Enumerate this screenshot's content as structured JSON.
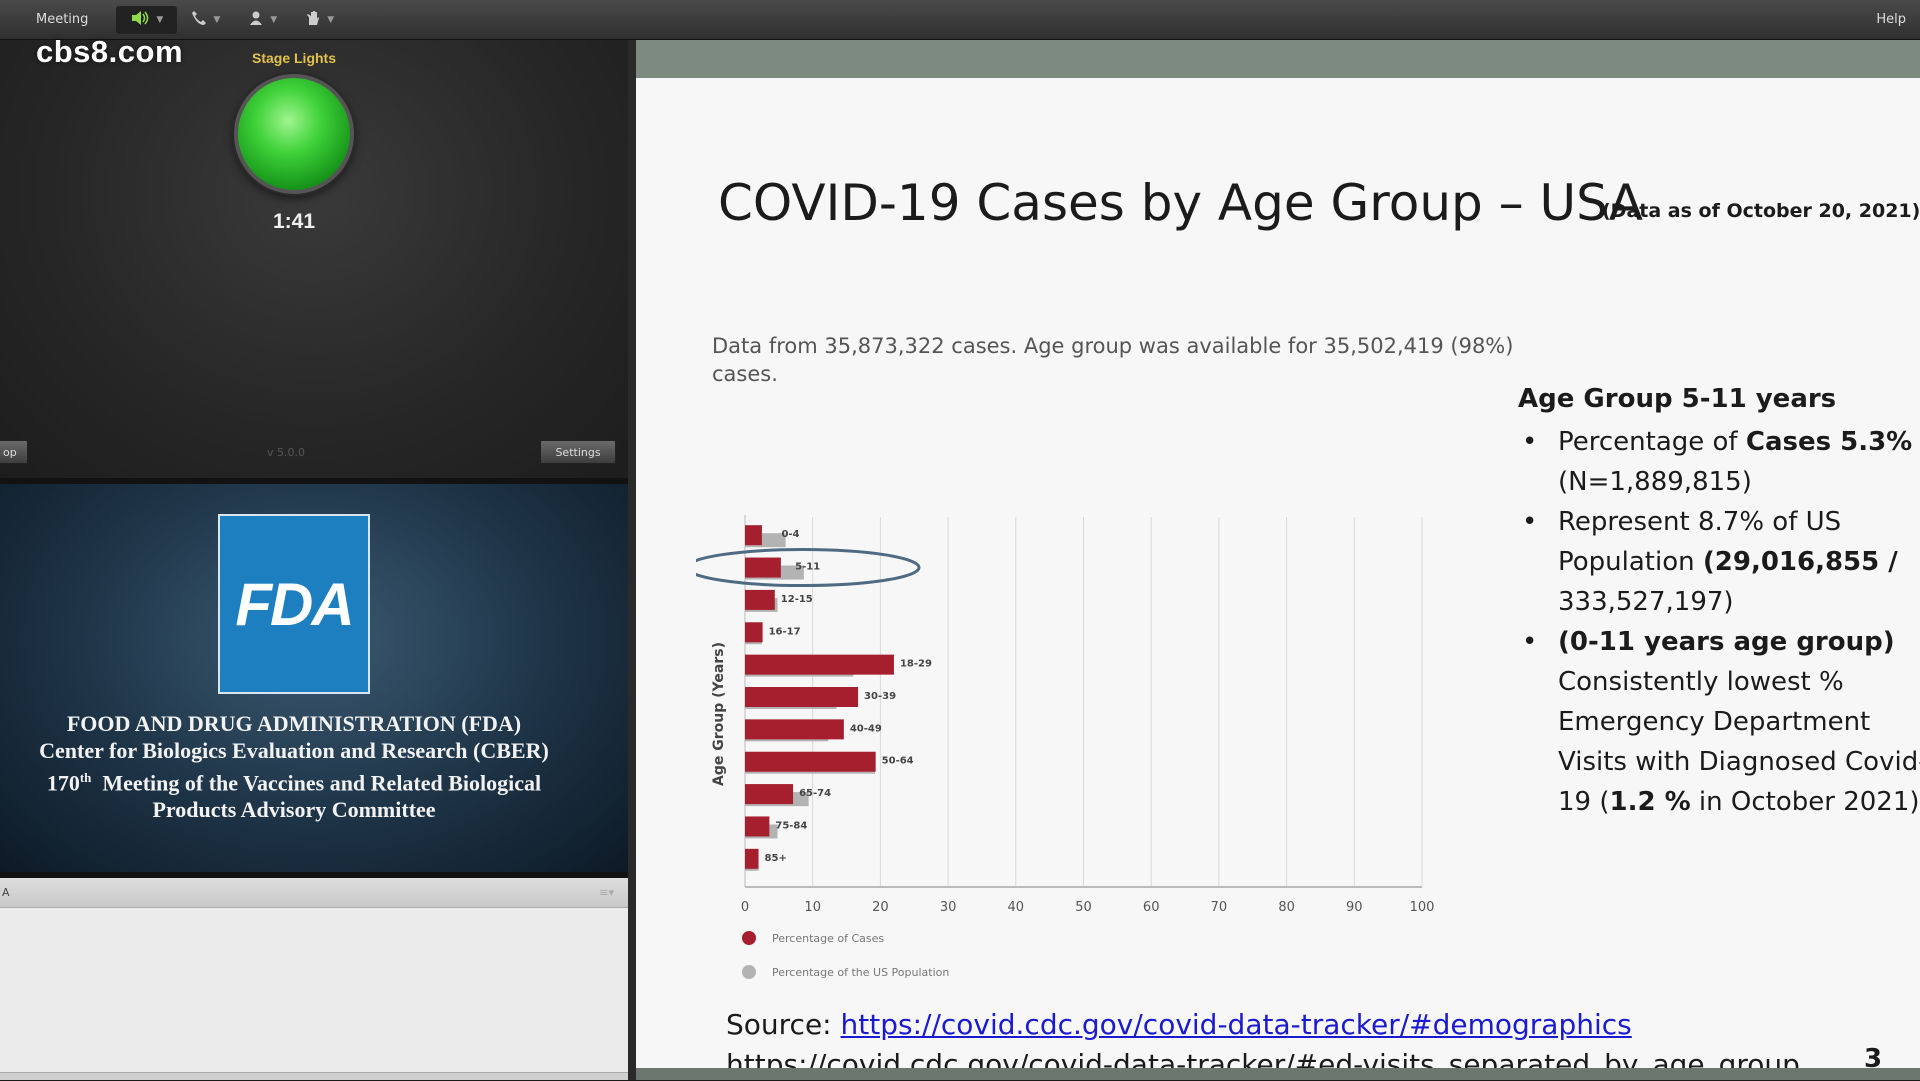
{
  "menubar": {
    "meeting_label": "Meeting",
    "help_label": "Help",
    "icons": [
      "speaker-icon",
      "phone-icon",
      "user-icon",
      "hand-raise-icon"
    ]
  },
  "watermark": "cbs8.com",
  "stage": {
    "title": "Stage Lights",
    "timer": "1:41",
    "light_color": "#3fd23a",
    "left_button": "op",
    "version": "v 5.0.0",
    "settings_button": "Settings"
  },
  "fda": {
    "logo_text": "FDA",
    "line1": "FOOD AND DRUG ADMINISTRATION (FDA)",
    "line2": "Center for Biologics Evaluation and Research (CBER)",
    "line3_num": "170",
    "line3_sup": "th",
    "line3_rest": "Meeting of the Vaccines and Related Biological",
    "line4": "Products Advisory Committee"
  },
  "chat": {
    "header": "A"
  },
  "slide": {
    "title": "COVID-19 Cases by Age Group – USA",
    "subtitle": "(Data as of October 20, 2021)",
    "note": "Data from 35,873,322 cases. Age group was available for 35,502,419 (98%) cases.",
    "side_heading": "Age Group 5-11 years",
    "bullets": [
      {
        "pre": "Percentage of ",
        "bold": "Cases 5.3%",
        "line2_pre": "",
        "line2_bold": "",
        "line2": "(N=1,889,815)"
      },
      {
        "pre": "Represent 8.7% of US",
        "line2_pre": "Population ",
        "line2_bold": "(29,016,855 /",
        "line3": "333,527,197)"
      },
      {
        "bold1": "(0-11 years age group)",
        "l2": "Consistently lowest %",
        "l3": "Emergency Department",
        "l4": "Visits with Diagnosed Covid-",
        "l5_pre": "19 (",
        "l5_bold": "1.2 %",
        "l5_post": " in October 2021)"
      }
    ],
    "source_label": "Source: ",
    "source_link": "https://covid.cdc.gov/covid-data-tracker/#demographics",
    "source_link2": "https://covid.cdc.gov/covid-data-tracker/#ed-visits_separated_by_age_group",
    "page_number": "3",
    "legend": [
      "Percentage of Cases",
      "Percentage of the US Population"
    ]
  },
  "chart_data": {
    "type": "bar",
    "orientation": "horizontal",
    "categories": [
      "0-4",
      "5-11",
      "12-15",
      "16-17",
      "18-29",
      "30-39",
      "40-49",
      "50-64",
      "65-74",
      "75-84",
      "85+"
    ],
    "series": [
      {
        "name": "Percentage of Cases",
        "values": [
          2.5,
          5.3,
          4.4,
          2.6,
          22.0,
          16.7,
          14.6,
          19.3,
          7.1,
          3.6,
          2.0
        ],
        "color": "#a51f2e"
      },
      {
        "name": "Percentage of the US Population",
        "values": [
          6.0,
          8.7,
          4.8,
          2.5,
          16.0,
          13.5,
          12.3,
          19.2,
          9.4,
          4.8,
          2.0
        ],
        "color": "#b3b3b3"
      }
    ],
    "title": "",
    "xlabel": "",
    "ylabel": "Age Group (Years)",
    "xlim": [
      0,
      100
    ],
    "xticks": [
      0,
      10,
      20,
      30,
      40,
      50,
      60,
      70,
      80,
      90,
      100
    ],
    "grid": true,
    "legend_position": "bottom-left",
    "highlight_category": "5-11",
    "highlight_color": "#4f6b83"
  }
}
